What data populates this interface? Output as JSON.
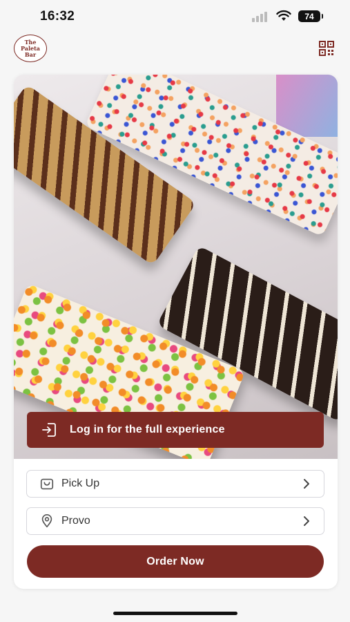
{
  "status_bar": {
    "time": "16:32",
    "battery": "74",
    "icons": [
      "signal-icon",
      "wifi-icon",
      "battery-icon"
    ]
  },
  "header": {
    "logo_lines": [
      "The",
      "Paleta",
      "Bar"
    ],
    "qr_icon": "qr-code-icon"
  },
  "hero": {
    "login_banner": {
      "label": "Log in for the full experience",
      "icon": "login-icon"
    }
  },
  "order_options": {
    "pickup": {
      "label": "Pick Up",
      "icon": "bag-icon"
    },
    "location": {
      "label": "Provo",
      "icon": "location-pin-icon"
    }
  },
  "order_button": {
    "label": "Order Now"
  },
  "colors": {
    "brand": "#7d2a24",
    "background": "#f6f6f6",
    "card": "#ffffff",
    "border": "#d6d6dc"
  }
}
